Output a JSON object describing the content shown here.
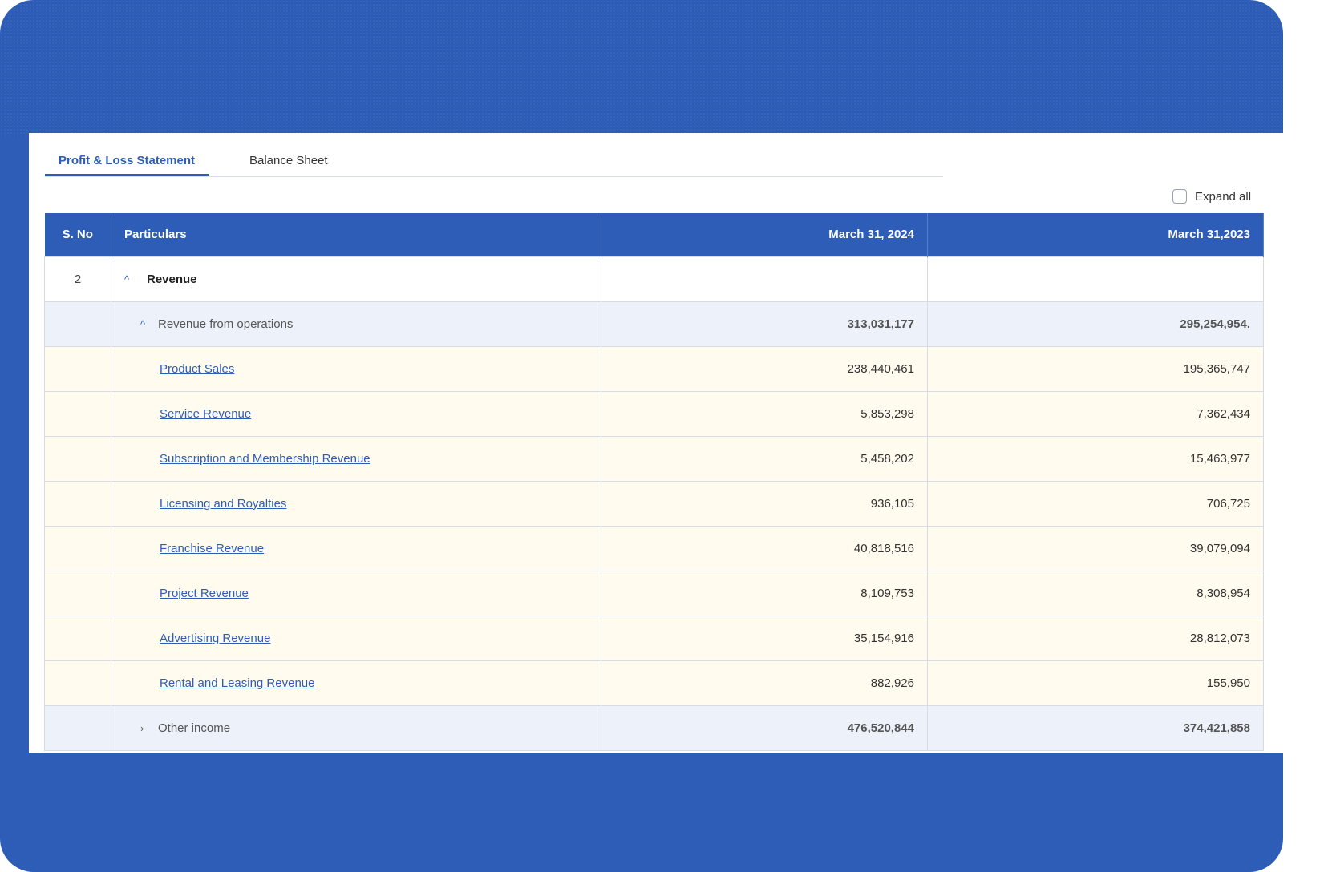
{
  "tabs": [
    {
      "label": "Profit & Loss Statement",
      "active": true
    },
    {
      "label": "Balance Sheet",
      "active": false
    }
  ],
  "expand_all": {
    "label": "Expand all",
    "checked": false
  },
  "table": {
    "headers": {
      "sno": "S. No",
      "particulars": "Particulars",
      "col1": "March 31, 2024",
      "col2": "March 31,2023"
    },
    "group": {
      "sno": "2",
      "label": "Revenue",
      "expanded": true,
      "caret": "^"
    },
    "subgroup": {
      "label": "Revenue from operations",
      "col1": "313,031,177",
      "col2": "295,254,954.",
      "caret": "^"
    },
    "items": [
      {
        "label": "Product Sales",
        "col1": "238,440,461",
        "col2": "195,365,747"
      },
      {
        "label": "Service Revenue",
        "col1": "5,853,298",
        "col2": "7,362,434"
      },
      {
        "label": "Subscription and Membership Revenue",
        "col1": "5,458,202",
        "col2": "15,463,977"
      },
      {
        "label": "Licensing and Royalties",
        "col1": "936,105",
        "col2": "706,725"
      },
      {
        "label": "Franchise Revenue",
        "col1": "40,818,516",
        "col2": "39,079,094"
      },
      {
        "label": "Project Revenue",
        "col1": "8,109,753",
        "col2": "8,308,954"
      },
      {
        "label": "Advertising Revenue",
        "col1": "35,154,916",
        "col2": "28,812,073"
      },
      {
        "label": "Rental and Leasing Revenue",
        "col1": "882,926",
        "col2": "155,950"
      }
    ],
    "other": {
      "label": "Other income",
      "col1": "476,520,844",
      "col2": "374,421,858",
      "caret": "›"
    }
  },
  "colors": {
    "accent": "#2e5db8",
    "item_row_bg": "#fffbee",
    "sub_row_bg": "#edf2fa"
  }
}
